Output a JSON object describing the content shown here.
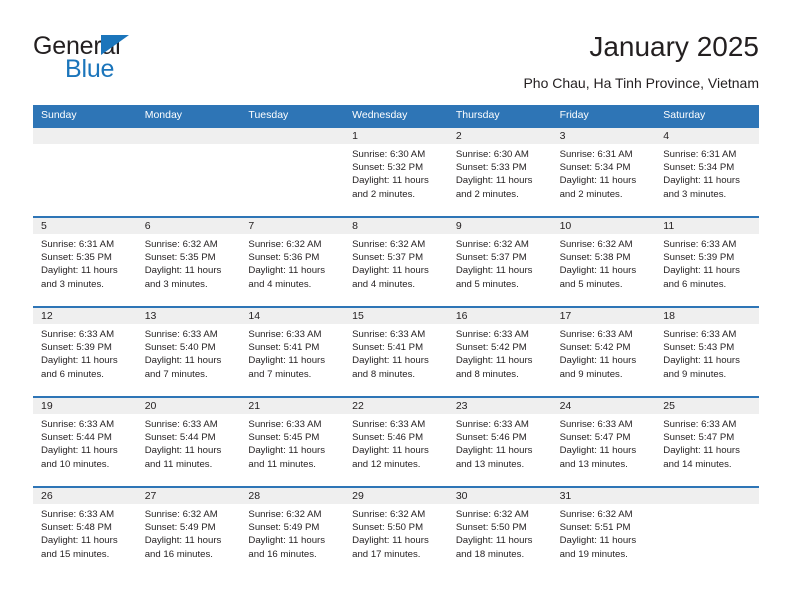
{
  "brand": {
    "name_part1": "General",
    "name_part2": "Blue",
    "triangle_color": "#1b75bb"
  },
  "header": {
    "title": "January 2025",
    "subtitle": "Pho Chau, Ha Tinh Province, Vietnam"
  },
  "colors": {
    "header_blue": "#2e75b6",
    "day_band_gray": "#efefef",
    "text": "#231f20"
  },
  "weekdays": [
    "Sunday",
    "Monday",
    "Tuesday",
    "Wednesday",
    "Thursday",
    "Friday",
    "Saturday"
  ],
  "weeks": [
    [
      {
        "day": "",
        "empty": true
      },
      {
        "day": "",
        "empty": true
      },
      {
        "day": "",
        "empty": true
      },
      {
        "day": "1",
        "sunrise": "Sunrise: 6:30 AM",
        "sunset": "Sunset: 5:32 PM",
        "daylight": "Daylight: 11 hours and 2 minutes."
      },
      {
        "day": "2",
        "sunrise": "Sunrise: 6:30 AM",
        "sunset": "Sunset: 5:33 PM",
        "daylight": "Daylight: 11 hours and 2 minutes."
      },
      {
        "day": "3",
        "sunrise": "Sunrise: 6:31 AM",
        "sunset": "Sunset: 5:34 PM",
        "daylight": "Daylight: 11 hours and 2 minutes."
      },
      {
        "day": "4",
        "sunrise": "Sunrise: 6:31 AM",
        "sunset": "Sunset: 5:34 PM",
        "daylight": "Daylight: 11 hours and 3 minutes."
      }
    ],
    [
      {
        "day": "5",
        "sunrise": "Sunrise: 6:31 AM",
        "sunset": "Sunset: 5:35 PM",
        "daylight": "Daylight: 11 hours and 3 minutes."
      },
      {
        "day": "6",
        "sunrise": "Sunrise: 6:32 AM",
        "sunset": "Sunset: 5:35 PM",
        "daylight": "Daylight: 11 hours and 3 minutes."
      },
      {
        "day": "7",
        "sunrise": "Sunrise: 6:32 AM",
        "sunset": "Sunset: 5:36 PM",
        "daylight": "Daylight: 11 hours and 4 minutes."
      },
      {
        "day": "8",
        "sunrise": "Sunrise: 6:32 AM",
        "sunset": "Sunset: 5:37 PM",
        "daylight": "Daylight: 11 hours and 4 minutes."
      },
      {
        "day": "9",
        "sunrise": "Sunrise: 6:32 AM",
        "sunset": "Sunset: 5:37 PM",
        "daylight": "Daylight: 11 hours and 5 minutes."
      },
      {
        "day": "10",
        "sunrise": "Sunrise: 6:32 AM",
        "sunset": "Sunset: 5:38 PM",
        "daylight": "Daylight: 11 hours and 5 minutes."
      },
      {
        "day": "11",
        "sunrise": "Sunrise: 6:33 AM",
        "sunset": "Sunset: 5:39 PM",
        "daylight": "Daylight: 11 hours and 6 minutes."
      }
    ],
    [
      {
        "day": "12",
        "sunrise": "Sunrise: 6:33 AM",
        "sunset": "Sunset: 5:39 PM",
        "daylight": "Daylight: 11 hours and 6 minutes."
      },
      {
        "day": "13",
        "sunrise": "Sunrise: 6:33 AM",
        "sunset": "Sunset: 5:40 PM",
        "daylight": "Daylight: 11 hours and 7 minutes."
      },
      {
        "day": "14",
        "sunrise": "Sunrise: 6:33 AM",
        "sunset": "Sunset: 5:41 PM",
        "daylight": "Daylight: 11 hours and 7 minutes."
      },
      {
        "day": "15",
        "sunrise": "Sunrise: 6:33 AM",
        "sunset": "Sunset: 5:41 PM",
        "daylight": "Daylight: 11 hours and 8 minutes."
      },
      {
        "day": "16",
        "sunrise": "Sunrise: 6:33 AM",
        "sunset": "Sunset: 5:42 PM",
        "daylight": "Daylight: 11 hours and 8 minutes."
      },
      {
        "day": "17",
        "sunrise": "Sunrise: 6:33 AM",
        "sunset": "Sunset: 5:42 PM",
        "daylight": "Daylight: 11 hours and 9 minutes."
      },
      {
        "day": "18",
        "sunrise": "Sunrise: 6:33 AM",
        "sunset": "Sunset: 5:43 PM",
        "daylight": "Daylight: 11 hours and 9 minutes."
      }
    ],
    [
      {
        "day": "19",
        "sunrise": "Sunrise: 6:33 AM",
        "sunset": "Sunset: 5:44 PM",
        "daylight": "Daylight: 11 hours and 10 minutes."
      },
      {
        "day": "20",
        "sunrise": "Sunrise: 6:33 AM",
        "sunset": "Sunset: 5:44 PM",
        "daylight": "Daylight: 11 hours and 11 minutes."
      },
      {
        "day": "21",
        "sunrise": "Sunrise: 6:33 AM",
        "sunset": "Sunset: 5:45 PM",
        "daylight": "Daylight: 11 hours and 11 minutes."
      },
      {
        "day": "22",
        "sunrise": "Sunrise: 6:33 AM",
        "sunset": "Sunset: 5:46 PM",
        "daylight": "Daylight: 11 hours and 12 minutes."
      },
      {
        "day": "23",
        "sunrise": "Sunrise: 6:33 AM",
        "sunset": "Sunset: 5:46 PM",
        "daylight": "Daylight: 11 hours and 13 minutes."
      },
      {
        "day": "24",
        "sunrise": "Sunrise: 6:33 AM",
        "sunset": "Sunset: 5:47 PM",
        "daylight": "Daylight: 11 hours and 13 minutes."
      },
      {
        "day": "25",
        "sunrise": "Sunrise: 6:33 AM",
        "sunset": "Sunset: 5:47 PM",
        "daylight": "Daylight: 11 hours and 14 minutes."
      }
    ],
    [
      {
        "day": "26",
        "sunrise": "Sunrise: 6:33 AM",
        "sunset": "Sunset: 5:48 PM",
        "daylight": "Daylight: 11 hours and 15 minutes."
      },
      {
        "day": "27",
        "sunrise": "Sunrise: 6:32 AM",
        "sunset": "Sunset: 5:49 PM",
        "daylight": "Daylight: 11 hours and 16 minutes."
      },
      {
        "day": "28",
        "sunrise": "Sunrise: 6:32 AM",
        "sunset": "Sunset: 5:49 PM",
        "daylight": "Daylight: 11 hours and 16 minutes."
      },
      {
        "day": "29",
        "sunrise": "Sunrise: 6:32 AM",
        "sunset": "Sunset: 5:50 PM",
        "daylight": "Daylight: 11 hours and 17 minutes."
      },
      {
        "day": "30",
        "sunrise": "Sunrise: 6:32 AM",
        "sunset": "Sunset: 5:50 PM",
        "daylight": "Daylight: 11 hours and 18 minutes."
      },
      {
        "day": "31",
        "sunrise": "Sunrise: 6:32 AM",
        "sunset": "Sunset: 5:51 PM",
        "daylight": "Daylight: 11 hours and 19 minutes."
      },
      {
        "day": "",
        "empty": true
      }
    ]
  ]
}
